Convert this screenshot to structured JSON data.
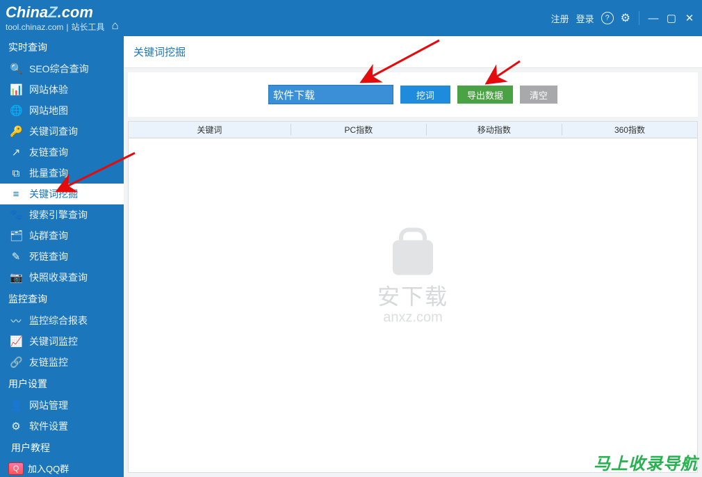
{
  "logo": {
    "brand_html": "ChinaZ.com",
    "subdomain": "tool.chinaz.com",
    "subtitle": "站长工具"
  },
  "titlebar": {
    "register": "注册",
    "login": "登录",
    "help_glyph": "?"
  },
  "sidebar": {
    "group1_title": "实时查询",
    "group1_items": [
      {
        "label": "SEO综合查询",
        "icon": "🔍",
        "name": "seo-combined"
      },
      {
        "label": "网站体验",
        "icon": "📊",
        "name": "site-experience"
      },
      {
        "label": "网站地图",
        "icon": "🌐",
        "name": "sitemap"
      },
      {
        "label": "关键词查询",
        "icon": "🔑",
        "name": "keyword-query"
      },
      {
        "label": "友链查询",
        "icon": "↗",
        "name": "friendlink-query"
      },
      {
        "label": "批量查询",
        "icon": "⧉",
        "name": "batch-query"
      },
      {
        "label": "关键词挖掘",
        "icon": "≡",
        "name": "keyword-mining",
        "active": true
      },
      {
        "label": "搜索引擎查询",
        "icon": "🐾",
        "name": "search-engine-query"
      },
      {
        "label": "站群查询",
        "icon": "🗂",
        "name": "sitegroup-query"
      },
      {
        "label": "死链查询",
        "icon": "✎",
        "name": "deadlink-query"
      },
      {
        "label": "快照收录查询",
        "icon": "📷",
        "name": "snapshot-index"
      }
    ],
    "group2_title": "监控查询",
    "group2_items": [
      {
        "label": "监控综合报表",
        "icon": "〰",
        "name": "monitor-report"
      },
      {
        "label": "关键词监控",
        "icon": "📈",
        "name": "keyword-monitor"
      },
      {
        "label": "友链监控",
        "icon": "🔗",
        "name": "friendlink-monitor"
      }
    ],
    "group3_title": "用户设置",
    "group3_items": [
      {
        "label": "网站管理",
        "icon": "👤",
        "name": "site-manage"
      },
      {
        "label": "软件设置",
        "icon": "⚙",
        "name": "software-settings"
      }
    ],
    "user_tutorial": "用户教程",
    "join_qq": "加入QQ群"
  },
  "main": {
    "crumb": "关键词挖掘",
    "input_value": "软件下载",
    "btn_search": "挖词",
    "btn_export": "导出数据",
    "btn_clear": "清空",
    "columns": [
      "关键词",
      "PC指数",
      "移动指数",
      "360指数"
    ]
  },
  "watermark": {
    "cn": "安下载",
    "en": "anxz.com"
  },
  "footer_note": "马上收录导航"
}
